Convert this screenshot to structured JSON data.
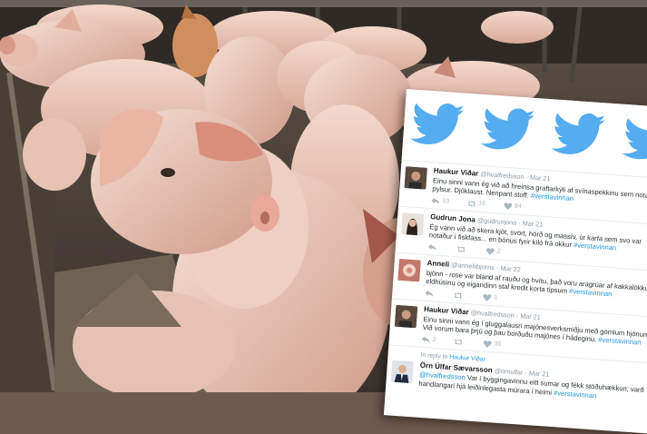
{
  "colors": {
    "twitter_blue": "#55acee",
    "hashtag": "#1b95e0",
    "card_bg": "#ffffff",
    "meta_text": "#8899a6"
  },
  "icons": [
    "twitter-bird-icon",
    "reply-icon",
    "retweet-icon",
    "like-icon"
  ],
  "tweets": [
    {
      "name": "Haukur Viðar",
      "handle": "@hvalfredsson",
      "time": "Mar 21",
      "text": "Einu sinni vann ég við að hreinsa graftarkýli af svínaspekkinu sem notað er í pylsur. Djóklaust. Nenpant stoff.",
      "hashtag": "#verstavinnan",
      "counts": {
        "replies": "10",
        "retweets": "16",
        "likes": "84"
      }
    },
    {
      "name": "Gudrun Jona",
      "handle": "@gudrunjona",
      "time": "Mar 21",
      "text": "Ég vann við að skera kjöt, svört, hörð og massív, úr karfa sem svo var notaður í fiskfass... en bónus fyrir kíló frá okkur",
      "hashtag": "#verstavinnan",
      "counts": {
        "replies": "",
        "retweets": "",
        "likes": "2"
      }
    },
    {
      "name": "Anneli",
      "handle": "@anneliibjorns",
      "time": "Mar 22",
      "text": "bjönn - rose var bland af rauðu og hvítu, það voru aragrúar af kakkalökkum í eldhúsinu og eigandinn stal kredit korta tipsum",
      "hashtag": "#verstavinnan",
      "counts": {
        "replies": "",
        "retweets": "",
        "likes": "1"
      }
    },
    {
      "name": "Haukur Viðar",
      "handle": "@hvalfredsson",
      "time": "Mar 21",
      "text": "Einu sinni vann ég í gluggalausri majónesverksmiðju með gömlum hjónum. Við vorum bara þrjú og þau borðuðu majónes í hádeginu.",
      "hashtag": "#verstavinnan",
      "counts": {
        "replies": "2",
        "retweets": "",
        "likes": "35"
      }
    },
    {
      "in_reply_prefix": "In reply to",
      "in_reply_name": "Haukur Viðar",
      "name": "Örn Úlfar Sævarsson",
      "handle": "@ornulfar",
      "time": "Mar 21",
      "mention": "@hvalfredsson",
      "text": "Var í byggingavinnu eitt sumar og fékk stöðuhækkun; varð handlangari hjá leiðinlegasta múrara í heimi",
      "hashtag": "#verstavinnan",
      "counts": {
        "replies": "",
        "retweets": "",
        "likes": ""
      }
    }
  ]
}
